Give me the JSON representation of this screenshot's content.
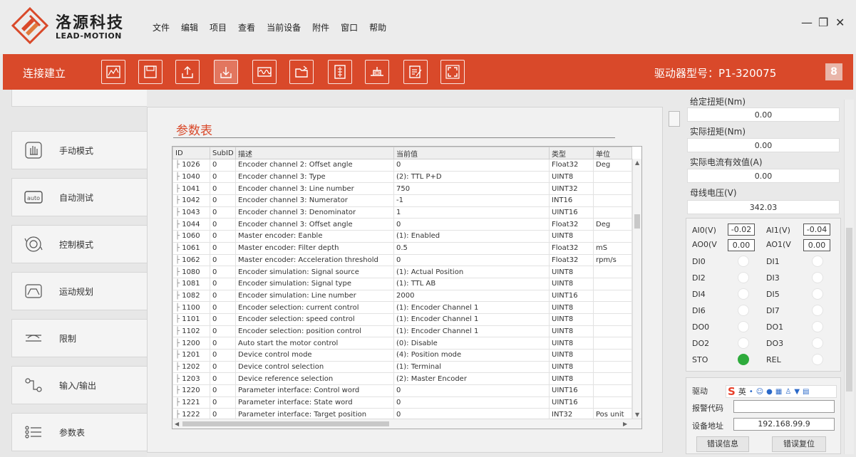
{
  "app": {
    "brand_cn": "洛源科技",
    "brand_en": "LEAD-MOTION",
    "menu": [
      "文件",
      "编辑",
      "项目",
      "查看",
      "当前设备",
      "附件",
      "窗口",
      "帮助"
    ]
  },
  "toolbar": {
    "connection_status": "连接建立",
    "model_label": "驱动器型号：P1-320075",
    "user_badge": "8",
    "accent": "#d9492a"
  },
  "nav": {
    "items": [
      {
        "label": "手动模式",
        "icon": "hand-icon"
      },
      {
        "label": "自动测试",
        "icon": "auto-icon"
      },
      {
        "label": "控制模式",
        "icon": "control-icon"
      },
      {
        "label": "运动规划",
        "icon": "curve-icon"
      },
      {
        "label": "限制",
        "icon": "limit-icon"
      },
      {
        "label": "输入/输出",
        "icon": "io-icon"
      },
      {
        "label": "参数表",
        "icon": "list-icon"
      }
    ]
  },
  "panel": {
    "title": "参数表",
    "columns": [
      "ID",
      "SubID",
      "描述",
      "当前值",
      "类型",
      "单位"
    ],
    "rows": [
      [
        "1026",
        "0",
        "Encoder channel 2: Offset angle",
        "0",
        "Float32",
        "Deg"
      ],
      [
        "1040",
        "0",
        "Encoder channel 3: Type",
        "(2): TTL P+D",
        "UINT8",
        ""
      ],
      [
        "1041",
        "0",
        "Encoder channel 3: Line number",
        "750",
        "UINT32",
        ""
      ],
      [
        "1042",
        "0",
        "Encoder channel 3: Numerator",
        "-1",
        "INT16",
        ""
      ],
      [
        "1043",
        "0",
        "Encoder channel 3: Denominator",
        "1",
        "UINT16",
        ""
      ],
      [
        "1044",
        "0",
        "Encoder channel 3: Offset angle",
        "0",
        "Float32",
        "Deg"
      ],
      [
        "1060",
        "0",
        "Master encoder: Eanble",
        "(1): Enabled",
        "UINT8",
        ""
      ],
      [
        "1061",
        "0",
        "Master encoder: Filter depth",
        "0.5",
        "Float32",
        "mS"
      ],
      [
        "1062",
        "0",
        "Master encoder: Acceleration threshold",
        "0",
        "Float32",
        "rpm/s"
      ],
      [
        "1080",
        "0",
        "Encoder simulation: Signal source",
        "(1): Actual Position",
        "UINT8",
        ""
      ],
      [
        "1081",
        "0",
        "Encoder simulation: Signal type",
        "(1): TTL AB",
        "UINT8",
        ""
      ],
      [
        "1082",
        "0",
        "Encoder simulation: Line number",
        "2000",
        "UINT16",
        ""
      ],
      [
        "1100",
        "0",
        "Encoder selection: current control",
        "(1): Encoder Channel 1",
        "UINT8",
        ""
      ],
      [
        "1101",
        "0",
        "Encoder selection: speed control",
        "(1): Encoder Channel 1",
        "UINT8",
        ""
      ],
      [
        "1102",
        "0",
        "Encoder selection: position control",
        "(1): Encoder Channel 1",
        "UINT8",
        ""
      ],
      [
        "1200",
        "0",
        "Auto start the motor control",
        "(0): Disable",
        "UINT8",
        ""
      ],
      [
        "1201",
        "0",
        "Device control mode",
        "(4): Position mode",
        "UINT8",
        ""
      ],
      [
        "1202",
        "0",
        "Device control selection",
        "(1): Terminal",
        "UINT8",
        ""
      ],
      [
        "1203",
        "0",
        "Device reference selection",
        "(2): Master Encoder",
        "UINT8",
        ""
      ],
      [
        "1220",
        "0",
        "Parameter interface: Control word",
        "0",
        "UINT16",
        ""
      ],
      [
        "1221",
        "0",
        "Parameter interface: State word",
        "0",
        "UINT16",
        ""
      ],
      [
        "1222",
        "0",
        "Parameter interface: Target position",
        "0",
        "INT32",
        "Pos unit"
      ]
    ]
  },
  "right": {
    "label_0": "给定扭矩(Nm)",
    "value_0": "0.00",
    "label_1": "实际扭矩(Nm)",
    "value_1": "0.00",
    "label_2": "实际电流有效值(A)",
    "value_2": "0.00",
    "label_3": "母线电压(V)",
    "value_3": "342.03",
    "ai0_label": "AI0(V)",
    "ai0": "-0.02",
    "ai1_label": "AI1(V)",
    "ai1": "-0.04",
    "ao0_label": "AO0(V",
    "ao0": "0.00",
    "ao1_label": "AO1(V",
    "ao1": "0.00",
    "di": [
      {
        "l": "DI0",
        "on": false,
        "r": "DI1",
        "ron": false
      },
      {
        "l": "DI2",
        "on": false,
        "r": "DI3",
        "ron": false
      },
      {
        "l": "DI4",
        "on": false,
        "r": "DI5",
        "ron": false
      },
      {
        "l": "DI6",
        "on": false,
        "r": "DI7",
        "ron": false
      },
      {
        "l": "DO0",
        "on": false,
        "r": "DO1",
        "ron": false
      },
      {
        "l": "DO2",
        "on": false,
        "r": "DO3",
        "ron": false
      },
      {
        "l": "STO",
        "on": true,
        "r": "REL",
        "ron": false
      }
    ],
    "led_on_color": "#2eab3c",
    "status_label": "驱动",
    "ime_label": "英",
    "alarm_label": "报警代码",
    "alarm_value": "",
    "addr_label": "设备地址",
    "addr_value": "192.168.99.9",
    "err_info": "错误信息",
    "err_reset": "错误复位"
  }
}
